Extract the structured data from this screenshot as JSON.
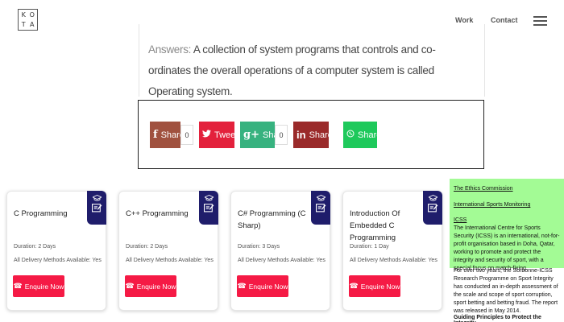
{
  "header": {
    "logo_letters": [
      "K",
      "O",
      "T",
      "A"
    ],
    "nav": {
      "work": "Work",
      "contact": "Contact"
    }
  },
  "answer": {
    "label": "Answers:",
    "text": "A collection of system programs that controls and co-ordinates the overall operations of a computer system is called Operating system."
  },
  "share": {
    "facebook": {
      "label": "Share",
      "count": "0",
      "icon": "f"
    },
    "twitter": {
      "label": "Tweet"
    },
    "googleplus": {
      "label": "Share",
      "count": "0",
      "icon": "g+"
    },
    "linkedin": {
      "label": "Share",
      "icon": "in"
    },
    "whatsapp": {
      "label": "Share"
    },
    "colors": {
      "facebook": "#a0513f",
      "twitter": "#e3213c",
      "googleplus": "#37b27f",
      "linkedin": "#9a2a2a",
      "whatsapp": "#1ec95b"
    }
  },
  "courses": [
    {
      "title": "C Programming",
      "duration": "Duration: 2 Days",
      "methods": "All Delivery Methods Available: Yes",
      "cta": "Enquire Now"
    },
    {
      "title": "C++ Programming",
      "duration": "Duration: 2 Days",
      "methods": "All Delivery Methods Available: Yes",
      "cta": "Enquire Now"
    },
    {
      "title": "C# Programming (C Sharp)",
      "duration": "Duration: 3 Days",
      "methods": "All Delivery Methods Available: Yes",
      "cta": "Enquire Now"
    },
    {
      "title": "Introduction Of Embedded C Programming",
      "duration": "Duration: 1 Day",
      "methods": "All Delivery Methods Available: Yes",
      "cta": "Enquire Now"
    }
  ],
  "colors": {
    "badge": "#1f1d6b",
    "enquire": "#f51a45",
    "sidebar_highlight": "#a3fb95"
  },
  "sidebar": {
    "ethics": "The Ethics Commission",
    "monitoring": "International Sports Monitoring",
    "icss": "ICSS",
    "icss_text": "The International Centre for Sports Security (ICSS) is an international, not-for-profit organisation based in Doha, Qatar, working to promote and protect the integrity and security of sport, with a special focus on match-fixing.",
    "sorbonne_text": "For over two years, the Sorbonne-ICSS Research Programme on Sport Integrity has conducted an in-depth assessment of the scale and scope of sport corruption, sport betting and betting fraud. The report was released in May 2014.",
    "guiding": "Guiding Principles to Protect the Integrity"
  }
}
